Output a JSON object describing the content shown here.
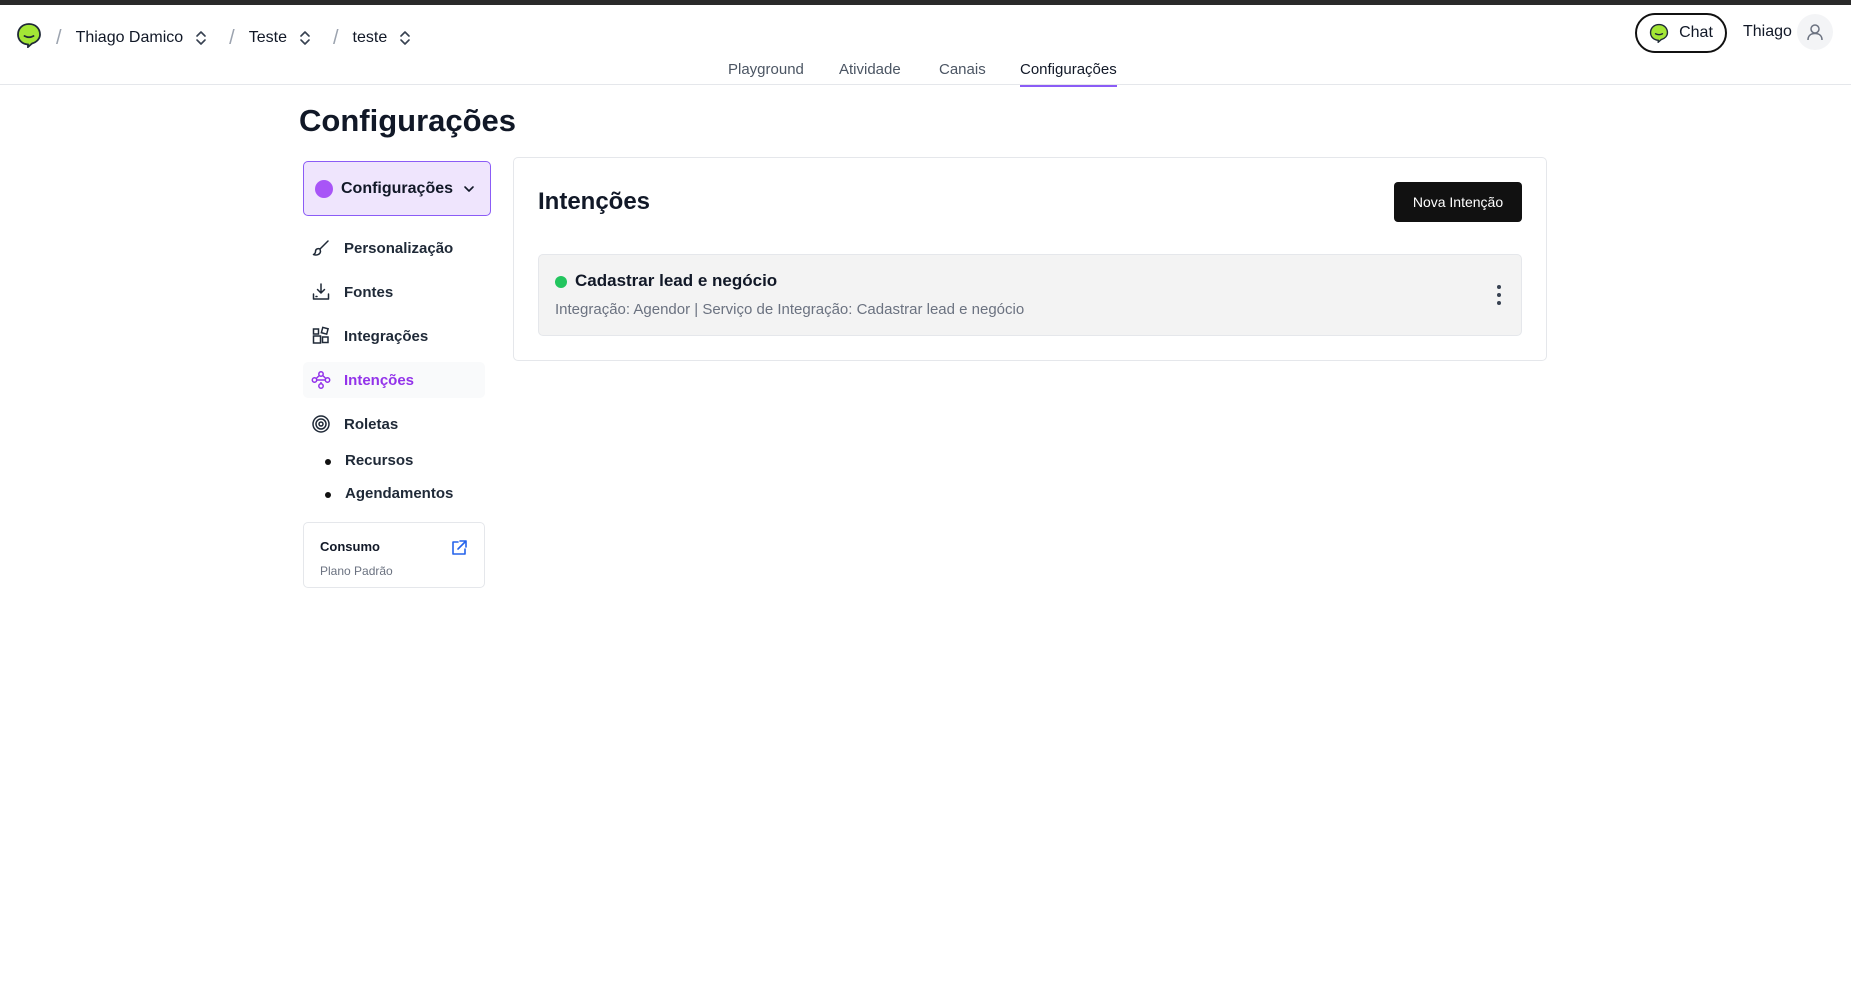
{
  "breadcrumb": {
    "items": [
      "Thiago Damico",
      "Teste",
      "teste"
    ]
  },
  "header": {
    "chat_label": "Chat",
    "user_name": "Thiago"
  },
  "tabs": [
    {
      "label": "Playground",
      "active": false
    },
    {
      "label": "Atividade",
      "active": false
    },
    {
      "label": "Canais",
      "active": false
    },
    {
      "label": "Configurações",
      "active": true
    }
  ],
  "page": {
    "title": "Configurações"
  },
  "sidebar": {
    "dropdown_label": "Configurações",
    "items": [
      {
        "label": "Personalização",
        "icon": "brush-icon"
      },
      {
        "label": "Fontes",
        "icon": "download-tray-icon"
      },
      {
        "label": "Integrações",
        "icon": "blocks-icon"
      },
      {
        "label": "Intenções",
        "icon": "workflow-icon",
        "active": true
      },
      {
        "label": "Roletas",
        "icon": "target-icon"
      }
    ],
    "subitems": [
      "Recursos",
      "Agendamentos"
    ],
    "consumo": {
      "title": "Consumo",
      "subtitle": "Plano Padrão"
    }
  },
  "main": {
    "title": "Intenções",
    "new_button": "Nova Intenção",
    "intents": [
      {
        "name": "Cadastrar lead e negócio",
        "description": "Integração: Agendor | Serviço de Integração: Cadastrar lead e negócio",
        "status_color": "#22c55e"
      }
    ]
  },
  "colors": {
    "accent": "#8b5cf6",
    "accent_text": "#9333ea",
    "logo": "#a3e635"
  }
}
